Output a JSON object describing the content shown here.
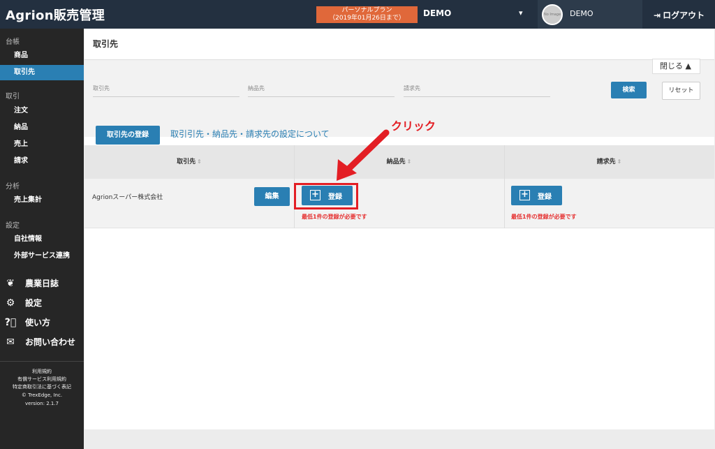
{
  "app": {
    "title": "Agrion販売管理"
  },
  "header": {
    "plan_line1": "パーソナルプラン",
    "plan_line2": "（2019年01月26日まで）",
    "tenant": "DEMO",
    "avatar_text": "No Image",
    "user": "DEMO",
    "logout": "ログアウト"
  },
  "sidebar": {
    "groups": [
      {
        "label": "台帳",
        "items": [
          {
            "label": "商品"
          },
          {
            "label": "取引先",
            "active": true
          }
        ]
      },
      {
        "label": "取引",
        "items": [
          {
            "label": "注文"
          },
          {
            "label": "納品"
          },
          {
            "label": "売上"
          },
          {
            "label": "請求"
          }
        ]
      },
      {
        "label": "分析",
        "items": [
          {
            "label": "売上集計"
          }
        ]
      },
      {
        "label": "設定",
        "items": [
          {
            "label": "自社情報"
          },
          {
            "label": "外部サービス連携"
          }
        ]
      }
    ],
    "big_items": [
      {
        "label": "農業日誌",
        "icon": "sprout-icon"
      },
      {
        "label": "設定",
        "icon": "gears-icon"
      },
      {
        "label": "使い方",
        "icon": "help-icon"
      },
      {
        "label": "お問い合わせ",
        "icon": "mail-icon"
      }
    ],
    "footer": {
      "terms": "利用規約",
      "paid_terms": "有償サービス利用規約",
      "law": "特定商取引法に基づく表記",
      "copyright": "© TrexEdge, Inc.",
      "version": "version: 2.1.7"
    }
  },
  "main": {
    "title": "取引先",
    "close_label": "閉じる ▲",
    "filters": {
      "customer": "取引先",
      "delivery": "納品先",
      "billing": "請求先"
    },
    "search_label": "検索",
    "reset_label": "リセット",
    "register_label": "取引先の登録",
    "info_link": "取引引先・納品先・請求先の設定について",
    "table": {
      "columns": [
        "取引先",
        "納品先",
        "請求先"
      ],
      "rows": [
        {
          "name": "Agrionスーパー株式会社",
          "edit_label": "編集",
          "register_label": "登録",
          "warning": "最低1件の登録が必要です"
        }
      ]
    }
  },
  "annotation": {
    "label": "クリック",
    "color": "#e31e24"
  }
}
